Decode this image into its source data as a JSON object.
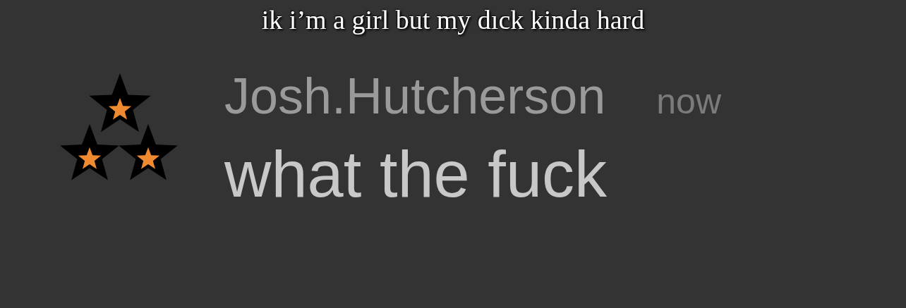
{
  "caption": "ik i’m a girl but my dıck kinda hard",
  "message": {
    "username": "Josh.Hutcherson",
    "time": "now",
    "text": "what the fuck"
  }
}
